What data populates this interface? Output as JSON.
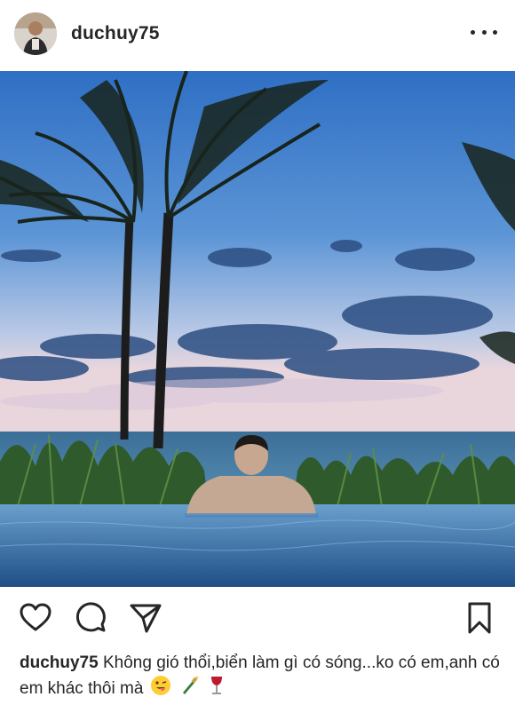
{
  "post": {
    "username": "duchuy75",
    "caption_user": "duchuy75",
    "caption_text": "Không gió thổi,biển làm gì có sóng...ko có em,anh có em khác thôi mà"
  },
  "icons": {
    "more": "more-options-icon",
    "like": "heart-icon",
    "comment": "comment-bubble-icon",
    "share": "paper-plane-icon",
    "save": "bookmark-icon",
    "emoji": [
      "winking-tongue-emoji",
      "bottle-emoji",
      "wine-glass-emoji"
    ]
  },
  "colors": {
    "text": "#262626",
    "sky": "#4a7fc4",
    "sea": "#2f6b9a",
    "pool": "#3a78b5"
  }
}
